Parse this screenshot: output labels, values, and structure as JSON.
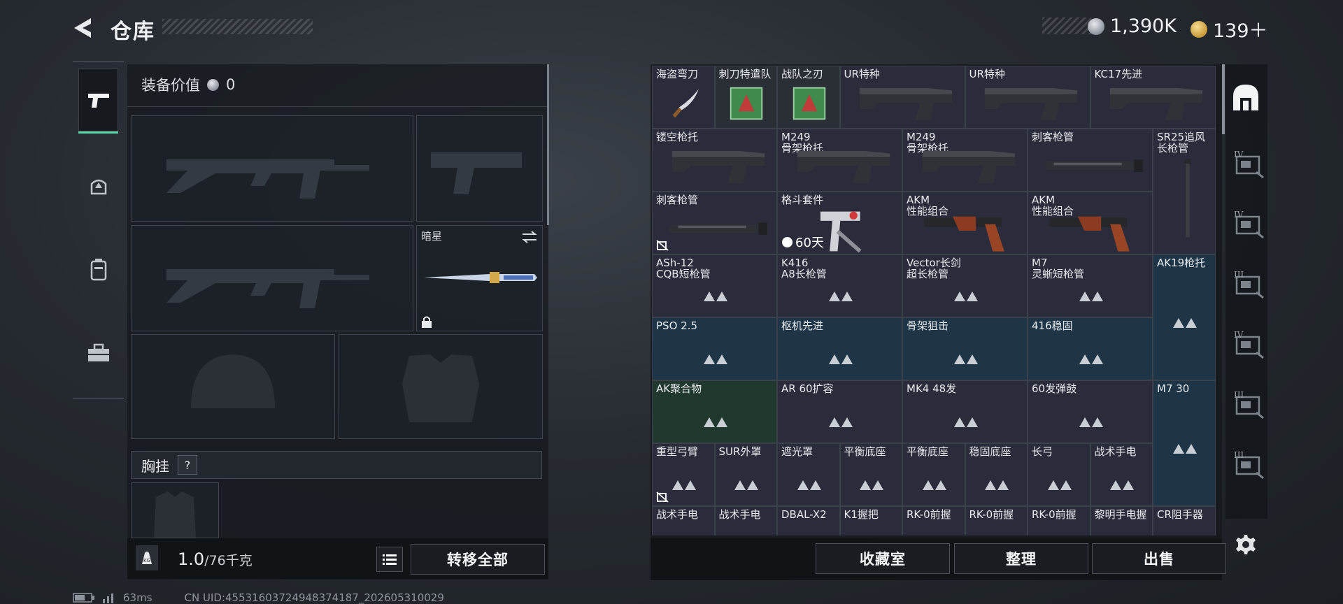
{
  "header": {
    "title": "仓库",
    "silver": "1,390K",
    "gold": "139＋"
  },
  "left": {
    "equip_value_label": "装备价值",
    "equip_value": "0",
    "melee_slot_label": "暗星",
    "vest_label": "胸挂",
    "vest_help": "?",
    "weight_current": "1.0",
    "weight_max": "/76千克",
    "transfer_all": "转移全部"
  },
  "grid": {
    "rows": [
      [
        {
          "t": "海盗弯刀",
          "w": 1,
          "k": "dark",
          "img": "knife"
        },
        {
          "t": "刺刀特遣队",
          "w": 1,
          "k": "gray",
          "img": "card"
        },
        {
          "t": "战队之刃",
          "w": 1,
          "k": "gray",
          "img": "card"
        },
        {
          "t": "UR特种",
          "w": 2,
          "k": "dark",
          "img": "stock"
        },
        {
          "t": "UR特种",
          "w": 2,
          "k": "dark",
          "img": "stock"
        },
        {
          "t": "KC17先进",
          "w": 2,
          "k": "dark",
          "img": "stock"
        }
      ],
      [
        {
          "t": "镂空枪托",
          "w": 2,
          "k": "dark",
          "img": "stock"
        },
        {
          "t": "M249\n骨架枪托",
          "w": 2,
          "k": "dark",
          "img": "stock"
        },
        {
          "t": "M249\n骨架枪托",
          "w": 2,
          "k": "dark",
          "img": "stock"
        },
        {
          "t": "刺客枪管",
          "w": 2,
          "k": "dark",
          "img": "barrel"
        },
        {
          "t": "SR25追风\n长枪管",
          "w": 1,
          "h": 2,
          "k": "dark",
          "img": "vbarrel"
        }
      ],
      [
        {
          "t": "刺客枪管",
          "w": 2,
          "k": "dark",
          "img": "barrel",
          "nodrop": true
        },
        {
          "t": "格斗套件",
          "w": 2,
          "k": "dark",
          "img": "kit",
          "timer": "60天"
        },
        {
          "t": "AKM\n性能组合",
          "w": 2,
          "k": "dark",
          "img": "grip"
        },
        {
          "t": "AKM\n性能组合",
          "w": 2,
          "k": "dark",
          "img": "grip"
        }
      ],
      [
        {
          "t": "ASh-12\nCQB短枪管",
          "w": 2,
          "k": "dark",
          "img": "tri"
        },
        {
          "t": "K416\nA8长枪管",
          "w": 2,
          "k": "dark",
          "img": "tri"
        },
        {
          "t": "Vector长剑\n超长枪管",
          "w": 2,
          "k": "dark",
          "img": "tri"
        },
        {
          "t": "M7\n灵蜥短枪管",
          "w": 2,
          "k": "dark",
          "img": "tri"
        },
        {
          "t": "AK19枪托",
          "w": 1,
          "h": 2,
          "k": "blue",
          "img": "tri"
        }
      ],
      [
        {
          "t": "PSO 2.5",
          "w": 2,
          "k": "blue",
          "img": "tri"
        },
        {
          "t": "枢机先进",
          "w": 2,
          "k": "blue",
          "img": "tri"
        },
        {
          "t": "骨架狙击",
          "w": 2,
          "k": "blue",
          "img": "tri"
        },
        {
          "t": "416稳固",
          "w": 2,
          "k": "blue",
          "img": "tri"
        }
      ],
      [
        {
          "t": "AK聚合物",
          "w": 2,
          "k": "green",
          "img": "tri"
        },
        {
          "t": "AR 60扩容",
          "w": 2,
          "k": "dark",
          "img": "tri"
        },
        {
          "t": "MK4 48发",
          "w": 2,
          "k": "dark",
          "img": "tri"
        },
        {
          "t": "60发弹鼓",
          "w": 2,
          "k": "dark",
          "img": "tri"
        },
        {
          "t": "M7 30",
          "w": 1,
          "h": 2,
          "k": "blue",
          "img": "tri"
        }
      ],
      [
        {
          "t": "重型弓臂",
          "w": 1,
          "k": "dark",
          "img": "tri",
          "nodrop": true
        },
        {
          "t": "SUR外罩",
          "w": 1,
          "k": "dark",
          "img": "tri"
        },
        {
          "t": "遮光罩",
          "w": 1,
          "k": "dark",
          "img": "tri"
        },
        {
          "t": "平衡底座",
          "w": 1,
          "k": "dark",
          "img": "tri"
        },
        {
          "t": "平衡底座",
          "w": 1,
          "k": "dark",
          "img": "tri"
        },
        {
          "t": "稳固底座",
          "w": 1,
          "k": "dark",
          "img": "tri"
        },
        {
          "t": "长弓",
          "w": 1,
          "k": "dark",
          "img": "tri"
        },
        {
          "t": "战术手电",
          "w": 1,
          "k": "dark",
          "img": "tri"
        }
      ],
      [
        {
          "t": "战术手电",
          "w": 1,
          "k": "dark",
          "img": "tri"
        },
        {
          "t": "战术手电",
          "w": 1,
          "k": "dark",
          "img": "tri"
        },
        {
          "t": "DBAL-X2",
          "w": 1,
          "k": "dark",
          "img": "tri"
        },
        {
          "t": "K1握把",
          "w": 1,
          "k": "dark",
          "img": "tri"
        },
        {
          "t": "RK-0前握",
          "w": 1,
          "k": "dark",
          "img": "tri"
        },
        {
          "t": "RK-0前握",
          "w": 1,
          "k": "dark",
          "img": "tri"
        },
        {
          "t": "RK-0前握",
          "w": 1,
          "k": "dark",
          "img": "tri"
        },
        {
          "t": "黎明手电握",
          "w": 1,
          "k": "dark",
          "img": "tri"
        },
        {
          "t": "CR阻手器",
          "w": 1,
          "k": "dark",
          "img": "tri"
        }
      ]
    ]
  },
  "right_tabs": [
    "IV",
    "IV",
    "III",
    "IV",
    "III",
    "III"
  ],
  "bottom": {
    "collection": "收藏室",
    "sort": "整理",
    "sell": "出售"
  },
  "status": {
    "ping": "63ms",
    "uid": "CN UID:45531603724948374187_202605310029"
  }
}
